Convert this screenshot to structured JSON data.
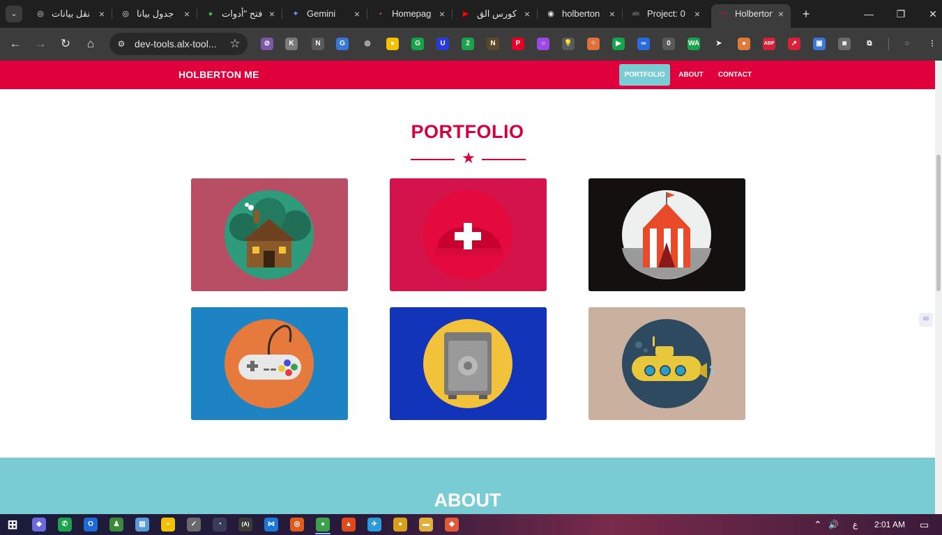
{
  "browser": {
    "tabs": [
      {
        "title": "نقل بيانات",
        "favicon": "chatgpt-icon",
        "favicon_glyph": "◎",
        "favicon_color": "#e3e3e3"
      },
      {
        "title": "جدول بيانا",
        "favicon": "chatgpt-icon",
        "favicon_glyph": "◎",
        "favicon_color": "#e3e3e3"
      },
      {
        "title": "فتح \"أدوات",
        "favicon": "chrome-icon",
        "favicon_glyph": "●",
        "favicon_color": "#4caf50"
      },
      {
        "title": "Gemini",
        "favicon": "gemini-icon",
        "favicon_glyph": "✦",
        "favicon_color": "#6b9bff"
      },
      {
        "title": "Homepag",
        "favicon": "photo-avatar-icon",
        "favicon_glyph": "▪",
        "favicon_color": "#a05050"
      },
      {
        "title": "كورس الق",
        "favicon": "youtube-icon",
        "favicon_glyph": "▶",
        "favicon_color": "#ff0000"
      },
      {
        "title": "holberton",
        "favicon": "github-icon",
        "favicon_glyph": "◉",
        "favicon_color": "#e3e3e3"
      },
      {
        "title": "Project: 0",
        "favicon": "alx-icon",
        "favicon_glyph": "alx",
        "favicon_color": "#9a9a9a"
      },
      {
        "title": "Holberton",
        "favicon": "holberton-icon",
        "favicon_glyph": "ꟷ",
        "favicon_color": "#e0003b"
      }
    ],
    "tab_search_glyph": "⌄",
    "close_glyph": "×",
    "new_tab_glyph": "+",
    "window_controls": {
      "minimize": "—",
      "maximize": "❐",
      "close": "✕"
    },
    "nav": {
      "back": "←",
      "forward": "→",
      "reload": "↻",
      "home": "⌂"
    },
    "url": "dev-tools.alx-tool...",
    "site_info_glyph": "⚙",
    "bookmark_glyph": "☆",
    "extensions": [
      {
        "name": "no-tracking-icon",
        "glyph": "⊘",
        "color": "#7a5aa8"
      },
      {
        "name": "extension-k-icon",
        "glyph": "K",
        "color": "#7a7a7a"
      },
      {
        "name": "notion-icon",
        "glyph": "N",
        "color": "#5a5a5a"
      },
      {
        "name": "google-translate-icon",
        "glyph": "G",
        "color": "#3a78d8"
      },
      {
        "name": "chatgpt-ext-icon",
        "glyph": "◎",
        "color": "#3c3c3c"
      },
      {
        "name": "keep-notes-icon",
        "glyph": "●",
        "color": "#f2c200"
      },
      {
        "name": "grammarly-icon",
        "glyph": "G",
        "color": "#16a34a"
      },
      {
        "name": "u-extension-icon",
        "glyph": "U",
        "color": "#2a3ad8"
      },
      {
        "name": "badge-two-icon",
        "glyph": "2",
        "color": "#1aa34a"
      },
      {
        "name": "nj-extension-icon",
        "glyph": "N",
        "color": "#5a4a2a"
      },
      {
        "name": "pinterest-icon",
        "glyph": "P",
        "color": "#e60023"
      },
      {
        "name": "rainbow-ring-icon",
        "glyph": "○",
        "color": "#9a4ae0"
      },
      {
        "name": "lightbulb-icon",
        "glyph": "💡",
        "color": "#5a5a5a"
      },
      {
        "name": "dots-grid-icon",
        "glyph": "⁘",
        "color": "#e0703a"
      },
      {
        "name": "screen-recorder-icon",
        "glyph": "▶",
        "color": "#16a34a"
      },
      {
        "name": "infinity-icon",
        "glyph": "∞",
        "color": "#2a6ae0"
      },
      {
        "name": "badge-zero-icon",
        "glyph": "0",
        "color": "#5a5a5a"
      },
      {
        "name": "whatsapp-web-icon",
        "glyph": "WA",
        "color": "#1aa34a"
      },
      {
        "name": "cursor-icon",
        "glyph": "➤",
        "color": "#3c3c3c"
      },
      {
        "name": "orange-drop-icon",
        "glyph": "●",
        "color": "#e07a3a"
      },
      {
        "name": "adblock-plus-icon",
        "glyph": "ABP",
        "color": "#d8203a"
      },
      {
        "name": "arrow-extension-icon",
        "glyph": "↗",
        "color": "#d8203a"
      },
      {
        "name": "screen-capture-icon",
        "glyph": "▣",
        "color": "#3a78d8"
      },
      {
        "name": "camera-icon",
        "glyph": "◙",
        "color": "#6a6a6a"
      },
      {
        "name": "extensions-puzzle-icon",
        "glyph": "⧉",
        "color": "#3c3c3c"
      },
      {
        "name": "profile-icon",
        "glyph": "◌",
        "color": "#3c3c3c"
      },
      {
        "name": "menu-kebab-icon",
        "glyph": "⋮",
        "color": "#3c3c3c"
      }
    ]
  },
  "site": {
    "brand": "HOLBERTON ME",
    "nav": [
      {
        "label": "PORTFOLIO",
        "active": true
      },
      {
        "label": "ABOUT",
        "active": false
      },
      {
        "label": "CONTACT",
        "active": false
      }
    ],
    "portfolio_title": "PORTFOLIO",
    "divider_glyph": "★",
    "cards": [
      {
        "name": "cabin",
        "background": "#b84e64",
        "circle": "#2e9b7d"
      },
      {
        "name": "cake",
        "background": "#d4134b",
        "circle": "#e40a3e"
      },
      {
        "name": "circus-tent",
        "background": "#141010",
        "circle": "#eef0f0"
      },
      {
        "name": "game-controller",
        "background": "#1e83c3",
        "circle": "#e57a3c"
      },
      {
        "name": "safe",
        "background": "#1234b8",
        "circle": "#f2c23a"
      },
      {
        "name": "submarine",
        "background": "#cab09f",
        "circle": "#2e4a60"
      }
    ],
    "about_title": "ABOUT",
    "colors": {
      "primary": "#e0003b",
      "accent": "#79ccd4"
    }
  },
  "taskbar": {
    "apps": [
      {
        "name": "windows-start-icon",
        "glyph": "⊞",
        "color": "transparent"
      },
      {
        "name": "copilot-icon",
        "glyph": "◆",
        "color": "#6a6ae0"
      },
      {
        "name": "whatsapp-icon",
        "glyph": "✆",
        "color": "#1aa34a"
      },
      {
        "name": "outlook-icon",
        "glyph": "O",
        "color": "#1a6ad8"
      },
      {
        "name": "chess-icon",
        "glyph": "♟",
        "color": "#3a8a3a"
      },
      {
        "name": "notepad-icon",
        "glyph": "▤",
        "color": "#5a9ad8"
      },
      {
        "name": "sticky-notes-icon",
        "glyph": "▪",
        "color": "#f2c200"
      },
      {
        "name": "todo-icon",
        "glyph": "✓",
        "color": "#6a6a6a"
      },
      {
        "name": "clock-icon",
        "glyph": "◔",
        "color": "#3a3a5a"
      },
      {
        "name": "code-brackets-icon",
        "glyph": "(A)",
        "color": "#3a3a3a"
      },
      {
        "name": "vscode-icon",
        "glyph": "⋈",
        "color": "#1a78d8"
      },
      {
        "name": "ubuntu-icon",
        "glyph": "◎",
        "color": "#e05a1a"
      },
      {
        "name": "chrome-taskbar-icon",
        "glyph": "●",
        "color": "#3aa34a"
      },
      {
        "name": "brave-icon",
        "glyph": "▲",
        "color": "#e04a1a"
      },
      {
        "name": "telegram-icon",
        "glyph": "✈",
        "color": "#2a9ad8"
      },
      {
        "name": "chrome-profile-icon",
        "glyph": "●",
        "color": "#d8a01a"
      },
      {
        "name": "file-explorer-icon",
        "glyph": "▬",
        "color": "#e0b03a"
      },
      {
        "name": "git-icon",
        "glyph": "◆",
        "color": "#e05a3a"
      }
    ],
    "tray": {
      "chevron": "⌃",
      "volume": "🔊",
      "ime": "ع",
      "time": "2:01 AM",
      "notification_glyph": "▭"
    }
  }
}
